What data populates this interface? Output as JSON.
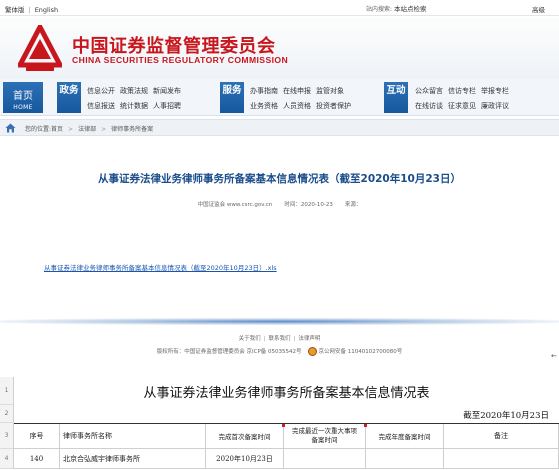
{
  "topbar": {
    "traditional": "繁体版",
    "english": "English",
    "search_label": "站内搜索:",
    "search_value": "本站点检索",
    "advanced": "高级"
  },
  "logo": {
    "name_cn": "中国证券监督管理委员会",
    "name_en": "CHINA SECURITIES REGULATORY COMMISSION",
    "color": "#c8161d"
  },
  "nav": {
    "home_cn": "首页",
    "home_en": "HOME",
    "groups": [
      {
        "cat": "政务",
        "links": [
          "信息公开",
          "政策法规",
          "新闻发布",
          "信息报送",
          "统计数据",
          "人事招聘"
        ]
      },
      {
        "cat": "服务",
        "links": [
          "办事指南",
          "在线申报",
          "监管对象",
          "业务资格",
          "人员资格",
          "投资者保护"
        ]
      },
      {
        "cat": "互动",
        "links": [
          "公众留言",
          "信访专栏",
          "举报专栏",
          "在线访谈",
          "征求意见",
          "廉政评议"
        ]
      }
    ]
  },
  "breadcrumb": {
    "prefix": "您的位置:",
    "items": [
      "首页",
      "法律部",
      "律师事务所备案"
    ]
  },
  "article": {
    "title": "从事证券法律业务律师事务所备案基本信息情况表（截至2020年10月23日）",
    "source": "中国证监会 www.csrc.gov.cn",
    "time": "时间：2020-10-23",
    "origin": "来源：",
    "attachment": "从事证券法律业务律师事务所备案基本信息情况表（截至2020年10月23日）.xls"
  },
  "footer": {
    "links": [
      "关于我们",
      "联系我们",
      "法律声明"
    ],
    "copyright": "版权所有：中国证券监督管理委员会 京ICP备 05035542号",
    "police": "京公网安备 11040102700080号"
  },
  "sheet": {
    "row_numbers": [
      "1",
      "2",
      "3",
      "4"
    ],
    "title": "从事证券法律业务律师事务所备案基本信息情况表",
    "date": "截至2020年10月23日",
    "headers": [
      "序号",
      "律师事务所名称",
      "完成首次备案时间",
      "完成最近一次重大事项备案时间",
      "完成年度备案时间",
      "备注"
    ],
    "rows": [
      [
        "140",
        "北京合弘威宇律师事务所",
        "2020年10月23日",
        "",
        "",
        ""
      ]
    ]
  },
  "colors": {
    "nav_blue": "#17589d",
    "title_blue": "#1a4d8c",
    "link_blue": "#1a56b0"
  }
}
